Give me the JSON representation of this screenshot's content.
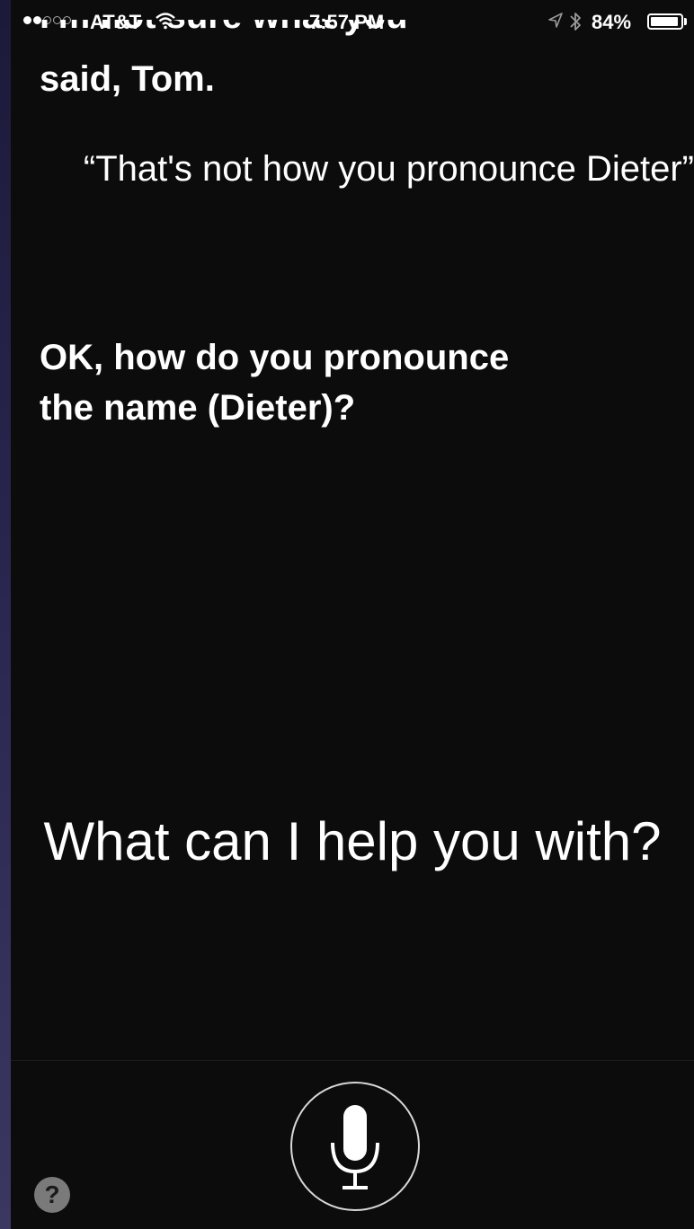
{
  "status_bar": {
    "carrier": "AT&T",
    "time": "7:57 PM",
    "battery_percent": "84%",
    "signal_bars_filled": 2,
    "signal_bars_total": 5,
    "wifi_icon": "wifi-icon",
    "location_icon": "location-arrow-icon",
    "bluetooth_icon": "bluetooth-icon"
  },
  "conversation": {
    "previous_line_cutoff": "I'm not sure what you",
    "siri_said": "said, Tom.",
    "user_quote": "“That's not how you pronounce Dieter”",
    "siri_reply": "OK, how do you pronounce the name (Dieter)?"
  },
  "prompt": {
    "text": "What can I help you with?"
  },
  "controls": {
    "mic_icon": "microphone-icon",
    "help_label": "?"
  },
  "colors": {
    "background": "#0c0c0d",
    "text": "#ffffff",
    "help_button": "#7a7a7a"
  }
}
